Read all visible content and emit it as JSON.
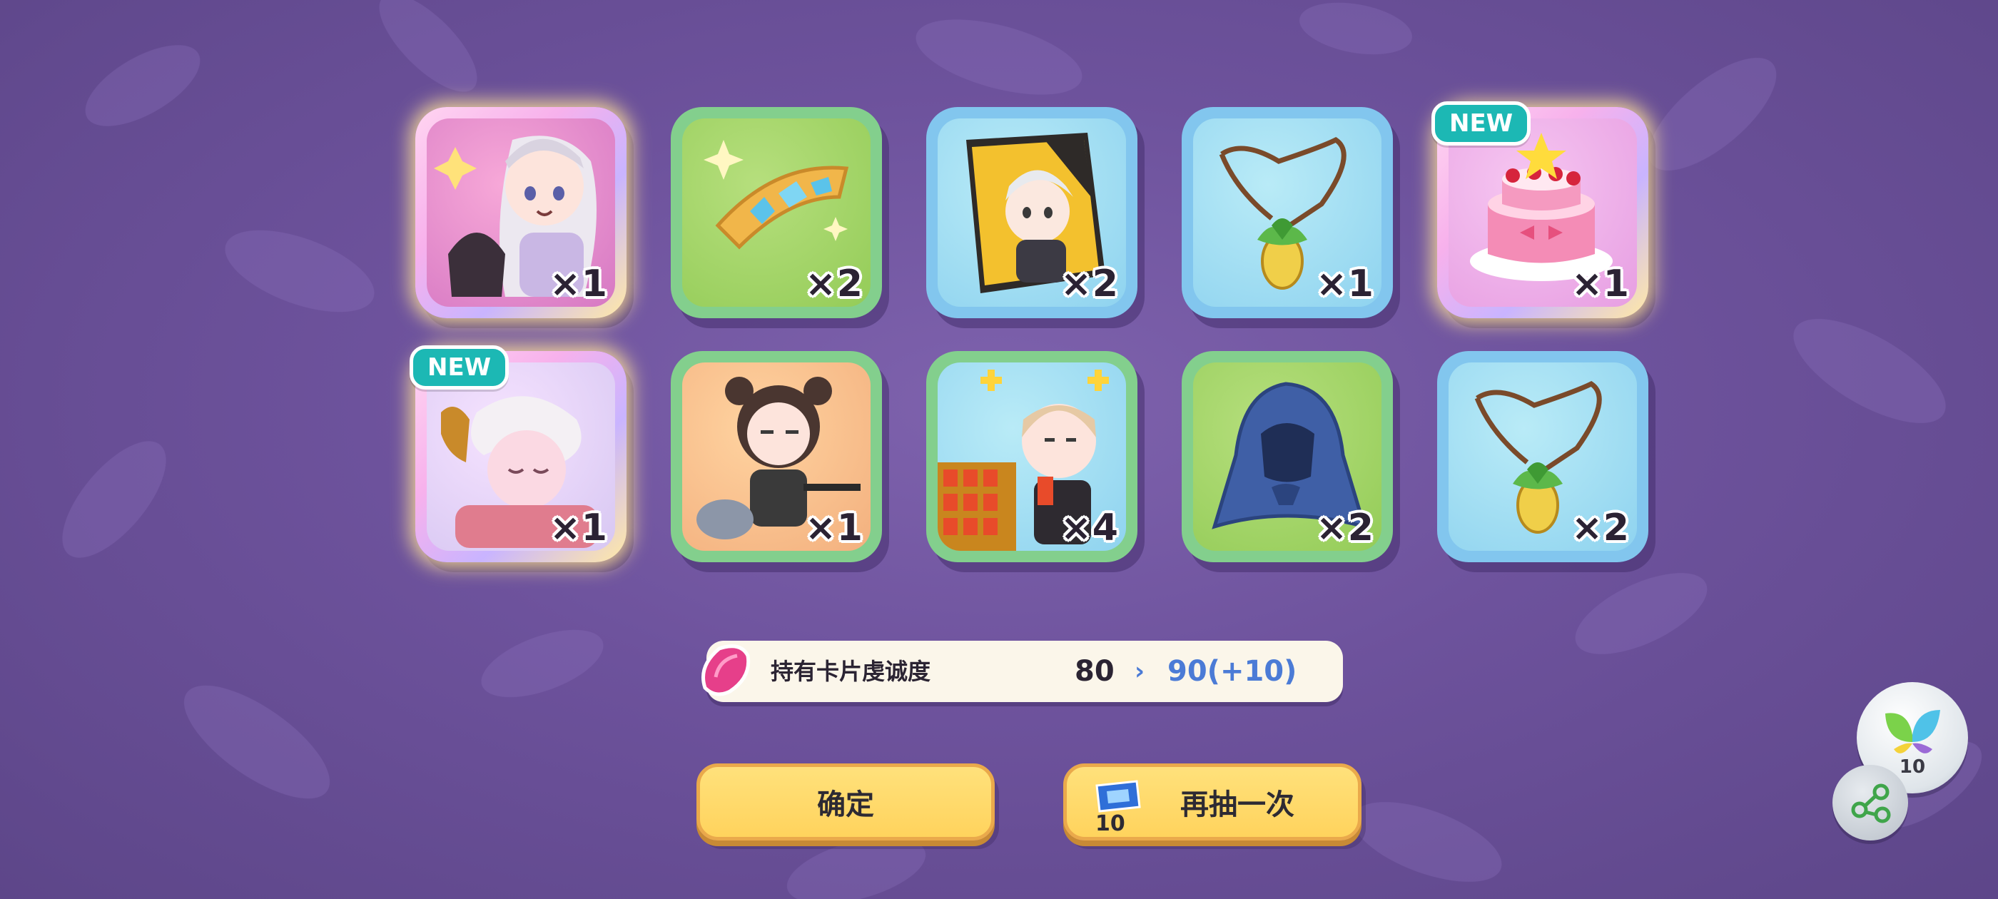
{
  "rewards": [
    {
      "qty": "×1",
      "frame": "rainbow",
      "badge": "",
      "item": "character-card"
    },
    {
      "qty": "×2",
      "frame": "green",
      "badge": "",
      "item": "crystal-crown"
    },
    {
      "qty": "×2",
      "frame": "blue",
      "badge": "",
      "item": "character-book"
    },
    {
      "qty": "×1",
      "frame": "blue",
      "badge": "",
      "item": "leaf-necklace"
    },
    {
      "qty": "×1",
      "frame": "rainbow",
      "badge": "NEW",
      "item": "cake"
    },
    {
      "qty": "×1",
      "frame": "rainbow",
      "badge": "NEW",
      "item": "sleeping-character"
    },
    {
      "qty": "×1",
      "frame": "green",
      "badge": "",
      "item": "bear-character"
    },
    {
      "qty": "×4",
      "frame": "green",
      "badge": "",
      "item": "merchant-character"
    },
    {
      "qty": "×2",
      "frame": "green",
      "badge": "",
      "item": "blue-hood"
    },
    {
      "qty": "×2",
      "frame": "blue",
      "badge": "",
      "item": "leaf-necklace"
    }
  ],
  "devotion": {
    "label": "持有卡片虔诚度",
    "current": "80",
    "arrow": "›",
    "next": "90(+10)"
  },
  "buttons": {
    "confirm": "确定",
    "again": "再抽一次",
    "ticket_count": "10"
  },
  "side": {
    "leaf_count": "10"
  },
  "colors": {
    "background": "#6d529c",
    "button": "#ffd35d",
    "accent_blue": "#4b7bd6",
    "badge_teal": "#1cb8b4"
  }
}
